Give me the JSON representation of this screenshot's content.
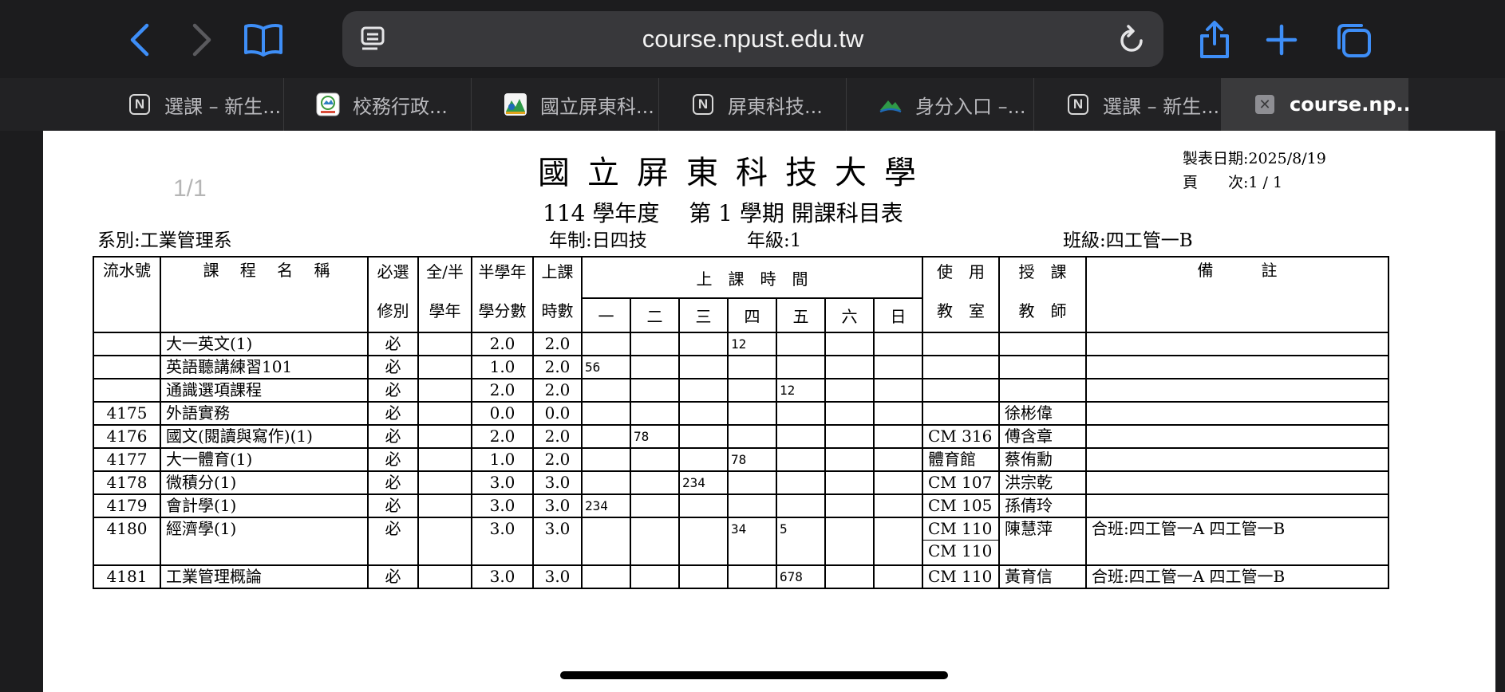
{
  "browser": {
    "url": "course.npust.edu.tw",
    "tabs": [
      {
        "label": "選課 – 新生...",
        "icon": "notion-icon"
      },
      {
        "label": "校務行政...",
        "icon": "npust-logo-icon"
      },
      {
        "label": "國立屏東科...",
        "icon": "npust-emblem-icon"
      },
      {
        "label": "屏東科技...",
        "icon": "notion-icon"
      },
      {
        "label": "身分入口 –...",
        "icon": "mountain-logo-icon"
      },
      {
        "label": "選課 – 新生...",
        "icon": "notion-icon"
      },
      {
        "label": "course.np...",
        "icon": "close-icon",
        "active": true
      }
    ],
    "accent_color": "#3e8ef7"
  },
  "document": {
    "page_indicator": "1/1",
    "title": "國立屏東科技大學",
    "subtitle": "114 學年度　 第 1 學期 開課科目表",
    "print_date": "製表日期:2025/8/19",
    "page_label": "頁　　次:1 / 1",
    "department": "系別:工業管理系",
    "system": "年制:日四技",
    "grade": "年級:1",
    "class_name": "班級:四工管一B",
    "headers": {
      "serial": "流水號",
      "course": "課　 程　 名　 稱",
      "req_top": "必選",
      "req_bottom": "修別",
      "term_top": "全/半",
      "term_bottom": "學年",
      "credit_top": "半學年",
      "credit_bottom": "學分數",
      "hours_top": "上課",
      "hours_bottom": "時數",
      "time": "上　課　時　間",
      "days": [
        "一",
        "二",
        "三",
        "四",
        "五",
        "六",
        "日"
      ],
      "room_top": "使　用",
      "room_bottom": "教　室",
      "teacher_top": "授　課",
      "teacher_bottom": "教　師",
      "remark": "備　　　註"
    },
    "rows": [
      {
        "serial": "",
        "name": "大一英文(1)",
        "req": "必",
        "term": "",
        "credits": "2.0",
        "hours": "2.0",
        "days": [
          "",
          "",
          "",
          "12",
          "",
          "",
          ""
        ],
        "room": "",
        "teacher": "",
        "remark": ""
      },
      {
        "serial": "",
        "name": "英語聽講練習101",
        "req": "必",
        "term": "",
        "credits": "1.0",
        "hours": "2.0",
        "days": [
          "56",
          "",
          "",
          "",
          "",
          "",
          ""
        ],
        "room": "",
        "teacher": "",
        "remark": ""
      },
      {
        "serial": "",
        "name": "通識選項課程",
        "req": "必",
        "term": "",
        "credits": "2.0",
        "hours": "2.0",
        "days": [
          "",
          "",
          "",
          "",
          "12",
          "",
          ""
        ],
        "room": "",
        "teacher": "",
        "remark": ""
      },
      {
        "serial": "4175",
        "name": "外語實務",
        "req": "必",
        "term": "",
        "credits": "0.0",
        "hours": "0.0",
        "days": [
          "",
          "",
          "",
          "",
          "",
          "",
          ""
        ],
        "room": "",
        "teacher": "徐彬偉",
        "remark": ""
      },
      {
        "serial": "4176",
        "name": "國文(閱讀與寫作)(1)",
        "req": "必",
        "term": "",
        "credits": "2.0",
        "hours": "2.0",
        "days": [
          "",
          "78",
          "",
          "",
          "",
          "",
          ""
        ],
        "room": "CM 316",
        "teacher": "傅含章",
        "remark": ""
      },
      {
        "serial": "4177",
        "name": "大一體育(1)",
        "req": "必",
        "term": "",
        "credits": "1.0",
        "hours": "2.0",
        "days": [
          "",
          "",
          "",
          "78",
          "",
          "",
          ""
        ],
        "room": "體育館",
        "teacher": "蔡侑勳",
        "remark": ""
      },
      {
        "serial": "4178",
        "name": "微積分(1)",
        "req": "必",
        "term": "",
        "credits": "3.0",
        "hours": "3.0",
        "days": [
          "",
          "",
          "234",
          "",
          "",
          "",
          ""
        ],
        "room": "CM 107",
        "teacher": "洪宗乾",
        "remark": ""
      },
      {
        "serial": "4179",
        "name": "會計學(1)",
        "req": "必",
        "term": "",
        "credits": "3.0",
        "hours": "3.0",
        "days": [
          "234",
          "",
          "",
          "",
          "",
          "",
          ""
        ],
        "room": "CM 105",
        "teacher": "孫倩玲",
        "remark": ""
      },
      {
        "serial": "4180",
        "name": "經濟學(1)",
        "req": "必",
        "term": "",
        "credits": "3.0",
        "hours": "3.0",
        "days": [
          "",
          "",
          "",
          "34",
          "5",
          "",
          ""
        ],
        "room": "CM 110",
        "room2": "CM 110",
        "teacher": "陳慧萍",
        "remark": "合班:四工管一A 四工管一B"
      },
      {
        "serial": "4181",
        "name": "工業管理概論",
        "req": "必",
        "term": "",
        "credits": "3.0",
        "hours": "3.0",
        "days": [
          "",
          "",
          "",
          "",
          "678",
          "",
          ""
        ],
        "room": "CM 110",
        "teacher": "黃育信",
        "remark": "合班:四工管一A 四工管一B"
      }
    ]
  }
}
